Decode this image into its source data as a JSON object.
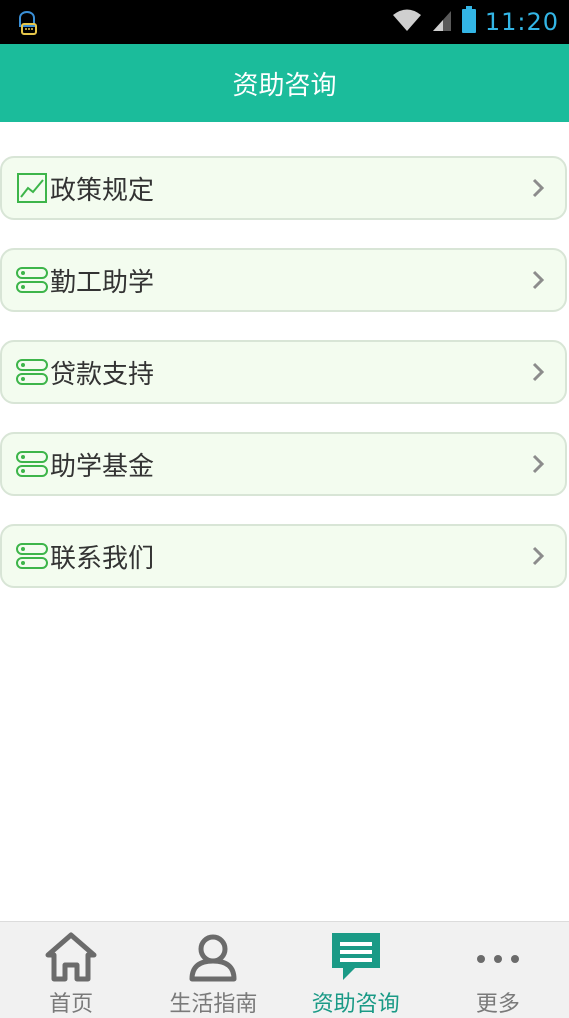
{
  "status_bar": {
    "time": "11:20",
    "icons": [
      "notification-app-icon",
      "wifi-icon",
      "signal-icon",
      "battery-icon"
    ]
  },
  "header": {
    "title": "资助咨询"
  },
  "menu": {
    "items": [
      {
        "label": "政策规定",
        "icon": "chart-line-icon"
      },
      {
        "label": "勤工助学",
        "icon": "toggle-list-icon"
      },
      {
        "label": "贷款支持",
        "icon": "toggle-list-icon"
      },
      {
        "label": "助学基金",
        "icon": "toggle-list-icon"
      },
      {
        "label": "联系我们",
        "icon": "toggle-list-icon"
      }
    ]
  },
  "tabs": [
    {
      "label": "首页",
      "icon": "home-icon",
      "active": false
    },
    {
      "label": "生活指南",
      "icon": "user-icon",
      "active": false
    },
    {
      "label": "资助咨询",
      "icon": "chat-icon",
      "active": true
    },
    {
      "label": "更多",
      "icon": "more-icon",
      "active": false
    }
  ],
  "colors": {
    "accent": "#1bbc9b",
    "active_tab": "#1a9a86",
    "item_bg": "#f3fcef",
    "item_border": "#d8e5d6",
    "icon_green": "#3db54a",
    "clock": "#33b5e5"
  }
}
